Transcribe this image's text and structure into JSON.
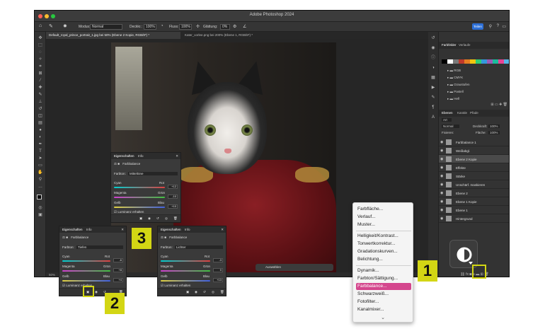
{
  "app": {
    "title": "Adobe Photoshop 2024",
    "zoom": "50%"
  },
  "options_bar": {
    "modus_label": "Modus:",
    "modus_value": "Normal",
    "deckkraft_label": "Deckkr.:",
    "deckkraft_value": "100%",
    "fluss_label": "Fluss:",
    "fluss_value": "100%",
    "glaettung_label": "Glättung:",
    "glaettung_value": "0%",
    "share_label": "Teilen"
  },
  "tabs": [
    {
      "label": "Default_royal_prince_portrait_1.jpg bei 50% (Ebene 2 Kopie, RGB/8*) *"
    },
    {
      "label": "Kater_vorlee.png bei 200% (Ebene 1, RGB/8*) *"
    }
  ],
  "right_panel": {
    "top_tabs": [
      "Farbfelder",
      "Verlaufe"
    ],
    "swatch_colors": [
      "#000000",
      "#ffffff",
      "#7a7a7a",
      "#c0392b",
      "#e67e22",
      "#f1c40f",
      "#2ecc71",
      "#3498db",
      "#9b59b6",
      "#1abc9c",
      "#e84393",
      "#55b7e8"
    ],
    "folders": [
      "RGB",
      "CMYK",
      "Graustufen",
      "Pastell",
      "Hell"
    ],
    "layer_tabs": [
      "Ebenen",
      "Kanäle",
      "Pfade"
    ],
    "filter_label": "Art",
    "blend_mode": "Normal",
    "opacity_label": "Deckkraft:",
    "opacity_value": "100%",
    "fix_label": "Fixieren:",
    "fill_label": "Fläche:",
    "fill_value": "100%",
    "layers": [
      {
        "name": "Farbbalance 1",
        "selected": false
      },
      {
        "name": "Weißabgl.",
        "selected": false
      },
      {
        "name": "Ebene 2 Kopie",
        "selected": true
      },
      {
        "name": "Effekte",
        "selected": false
      },
      {
        "name": "Stärke",
        "selected": false
      },
      {
        "name": "Unschärf. maskieren",
        "selected": false
      },
      {
        "name": "Ebene 2",
        "selected": false
      },
      {
        "name": "Ebene 1 Kopie",
        "selected": false
      },
      {
        "name": "Ebene 1",
        "selected": false
      },
      {
        "name": "Hintergrund",
        "selected": false
      }
    ]
  },
  "props_common": {
    "tab_properties": "Eigenschaften",
    "tab_info": "Info",
    "adj_title": "Farbbalance",
    "tone_label": "Farbton:",
    "cyan": "Cyan",
    "rot": "Rot",
    "magenta": "Magenta",
    "gruen": "Grün",
    "gelb": "Gelb",
    "blau": "Blau",
    "luminanz": "Luminanz erhalten"
  },
  "props_mitten": {
    "tone": "Mitteltöne",
    "v1": "+12",
    "v2": "-10",
    "v3": "+10"
  },
  "props_tiefen": {
    "tone": "Tiefen",
    "v1": "-6",
    "v2": "+8",
    "v3": "+4"
  },
  "props_lichter": {
    "tone": "Lichter",
    "v1": "-3",
    "v2": "0",
    "v3": "+13"
  },
  "canvas_toolbar": {
    "label": "Auswählen"
  },
  "menu": {
    "items": [
      {
        "label": "Farbfläche...",
        "highlighted": false
      },
      {
        "label": "Verlauf...",
        "highlighted": false
      },
      {
        "label": "Muster...",
        "highlighted": false
      },
      {
        "label": "Helligkeit/Kontrast...",
        "highlighted": false
      },
      {
        "label": "Tonwertkorrektur...",
        "highlighted": false
      },
      {
        "label": "Gradationskurven...",
        "highlighted": false
      },
      {
        "label": "Belichtung...",
        "highlighted": false
      },
      {
        "label": "Dynamik...",
        "highlighted": false
      },
      {
        "label": "Farbton/Sättigung...",
        "highlighted": false
      },
      {
        "label": "Farbbalance...",
        "highlighted": true
      },
      {
        "label": "Schwarzweiß...",
        "highlighted": false
      },
      {
        "label": "Fotofilter...",
        "highlighted": false
      },
      {
        "label": "Kanalmixer...",
        "highlighted": false
      }
    ],
    "more_glyph": "⌄"
  },
  "callouts": {
    "one": "1",
    "two": "2",
    "three": "3"
  },
  "accent": {
    "callout": "#d3d614",
    "menu_highlight": "#d4468d",
    "share": "#2d6fd6"
  }
}
